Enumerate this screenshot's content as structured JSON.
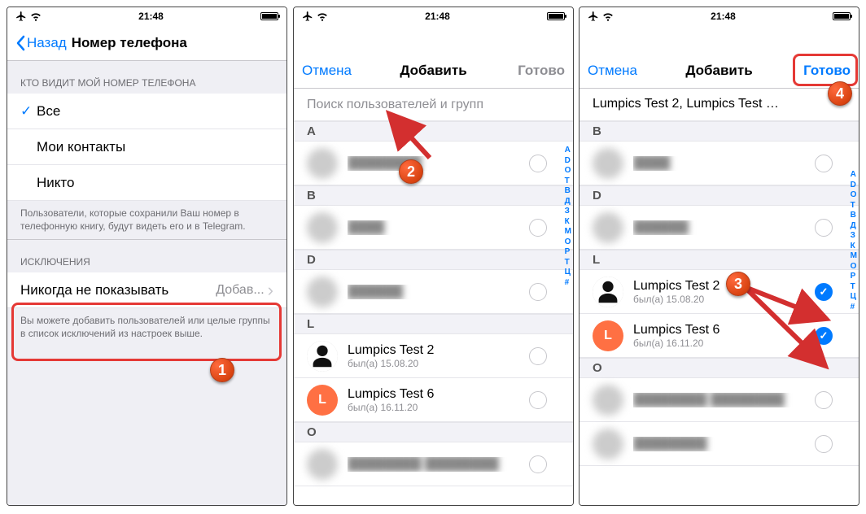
{
  "status": {
    "time": "21:48"
  },
  "screen1": {
    "back": "Назад",
    "title": "Номер телефона",
    "sectionWho": "КТО ВИДИТ МОЙ НОМЕР ТЕЛЕФОНА",
    "optAll": "Все",
    "optContacts": "Мои контакты",
    "optNobody": "Никто",
    "whoFooter": "Пользователи, которые сохранили Ваш номер в телефонную книгу, будут видеть его и в Telegram.",
    "sectionExc": "ИСКЛЮЧЕНИЯ",
    "neverShow": "Никогда не показывать",
    "addShort": "Добав...",
    "excFooter": "Вы можете добавить пользователей или целые группы в список исключений из настроек выше."
  },
  "picker": {
    "cancel": "Отмена",
    "title": "Добавить",
    "done": "Готово",
    "searchPlaceholder": "Поиск пользователей и групп",
    "selectedText": "Lumpics Test 2,  Lumpics Test …",
    "groups": {
      "A": "A",
      "B": "B",
      "D": "D",
      "L": "L",
      "O": "O"
    },
    "indexLetters": [
      "A",
      "D",
      "O",
      "Т",
      "В",
      "Д",
      "З",
      "К",
      "М",
      "О",
      "Р",
      "Т",
      "Ц",
      "#"
    ],
    "lumpics2": {
      "name": "Lumpics Test 2",
      "sub": "был(а) 15.08.20"
    },
    "lumpics6": {
      "name": "Lumpics Test 6",
      "sub": "был(а) 16.11.20"
    }
  },
  "badges": {
    "1": "1",
    "2": "2",
    "3": "3",
    "4": "4"
  }
}
